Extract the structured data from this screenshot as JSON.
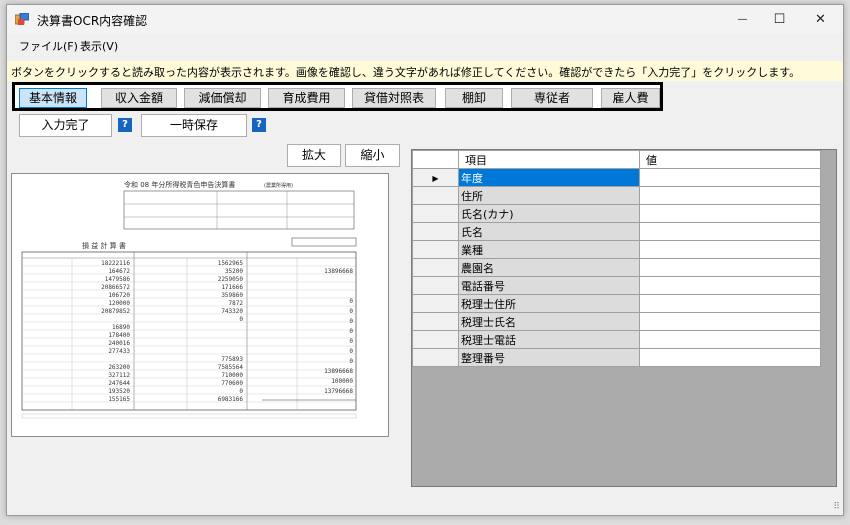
{
  "window": {
    "title": "決算書OCR内容確認",
    "minimize_glyph": "—",
    "maximize_glyph": "☐",
    "close_glyph": "✕"
  },
  "menu": {
    "items": [
      "ファイル(F)",
      "表示(V)"
    ]
  },
  "hint": "ボタンをクリックすると読み取った内容が表示されます。画像を確認し、違う文字があれば修正してください。確認ができたら「入力完了」をクリックします。",
  "tabs": [
    {
      "label": "基本情報",
      "active": true
    },
    {
      "label": "収入金額",
      "active": false
    },
    {
      "label": "減価償却",
      "active": false
    },
    {
      "label": "育成費用",
      "active": false
    },
    {
      "label": "貸借対照表",
      "active": false
    },
    {
      "label": "棚卸",
      "active": false
    },
    {
      "label": "専従者",
      "active": false
    },
    {
      "label": "雇人費",
      "active": false
    }
  ],
  "actions": {
    "complete_label": "入力完了",
    "save_label": "一時保存",
    "help_glyph": "?",
    "zoom_in_label": "拡大",
    "zoom_out_label": "縮小"
  },
  "document_preview": {
    "header": "令和 08 年分所得税青色申告決算書",
    "subheader": "(農業所得用)",
    "section_title": "損 益 計 算 書",
    "column_values_1": [
      "18222116",
      "164672",
      "1479586",
      "20866572",
      "106720",
      "120000",
      "20879852",
      "",
      "16890",
      "178400",
      "240016",
      "277433",
      "",
      "263200",
      "327112",
      "247644",
      "193520",
      "155165"
    ],
    "column_values_2": [
      "1562965",
      "35200",
      "2259050",
      "171666",
      "359860",
      "7872",
      "743320",
      "0",
      "",
      "",
      "",
      "",
      "775893",
      "7585564",
      "710000",
      "770600",
      "0",
      "6983166"
    ],
    "column_values_3": [
      "13896668",
      "",
      "",
      "0",
      "0",
      "0",
      "0",
      "0",
      "0",
      "0",
      "13896668",
      "100000",
      "13796668"
    ]
  },
  "grid": {
    "headers": [
      "",
      "項目",
      "値"
    ],
    "current_row_glyph": "▶",
    "rows": [
      {
        "item": "年度",
        "value": ""
      },
      {
        "item": "住所",
        "value": ""
      },
      {
        "item": "氏名(カナ)",
        "value": ""
      },
      {
        "item": "氏名",
        "value": ""
      },
      {
        "item": "業種",
        "value": ""
      },
      {
        "item": "農園名",
        "value": ""
      },
      {
        "item": "電話番号",
        "value": ""
      },
      {
        "item": "税理士住所",
        "value": ""
      },
      {
        "item": "税理士氏名",
        "value": ""
      },
      {
        "item": "税理士電話",
        "value": ""
      },
      {
        "item": "整理番号",
        "value": ""
      }
    ]
  },
  "colors": {
    "selected_row": "#0078d7",
    "active_tab": "#cce4f7",
    "hint_background": "#fffbd9",
    "help_icon": "#1565c0"
  }
}
